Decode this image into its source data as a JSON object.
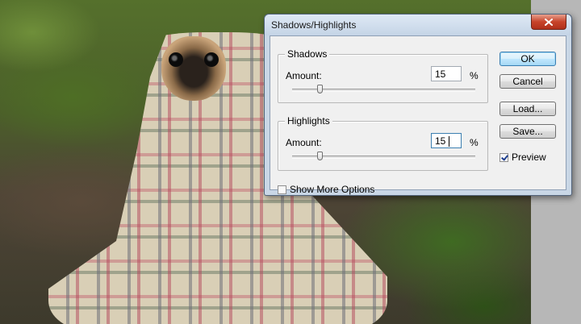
{
  "dialog": {
    "title": "Shadows/Highlights",
    "close_icon": "close-icon",
    "shadows": {
      "legend": "Shadows",
      "amount_label": "Amount:",
      "amount_value": "15",
      "unit": "%",
      "slider_percent": 15
    },
    "highlights": {
      "legend": "Highlights",
      "amount_label": "Amount:",
      "amount_value": "15",
      "unit": "%",
      "slider_percent": 15
    },
    "show_more_options": {
      "label": "Show More Options",
      "checked": false
    },
    "preview": {
      "label": "Preview",
      "checked": true
    },
    "buttons": {
      "ok": "OK",
      "cancel": "Cancel",
      "load": "Load...",
      "save": "Save..."
    }
  },
  "colors": {
    "titlebar": "#c4d4e6",
    "close_button": "#c7432a",
    "default_button_border": "#3c7fb1"
  }
}
